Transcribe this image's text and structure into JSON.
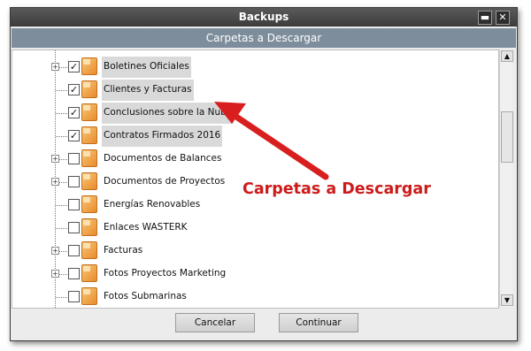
{
  "window": {
    "title": "Backups",
    "minimize_glyph": "▬",
    "close_glyph": "✕"
  },
  "header": {
    "title": "Carpetas a Descargar"
  },
  "tree": {
    "items": [
      {
        "label": "Boletines Oficiales",
        "checked": true,
        "expandable": true,
        "selected": true
      },
      {
        "label": "Clientes y Facturas",
        "checked": true,
        "expandable": false,
        "selected": true
      },
      {
        "label": "Conclusiones sobre la Nube",
        "checked": true,
        "expandable": false,
        "selected": true
      },
      {
        "label": "Contratos Firmados 2016",
        "checked": true,
        "expandable": false,
        "selected": true
      },
      {
        "label": "Documentos de Balances",
        "checked": false,
        "expandable": true,
        "selected": false
      },
      {
        "label": "Documentos de Proyectos",
        "checked": false,
        "expandable": true,
        "selected": false
      },
      {
        "label": "Energías Renovables",
        "checked": false,
        "expandable": false,
        "selected": false
      },
      {
        "label": "Enlaces WASTERK",
        "checked": false,
        "expandable": false,
        "selected": false
      },
      {
        "label": "Facturas",
        "checked": false,
        "expandable": true,
        "selected": false
      },
      {
        "label": "Fotos Proyectos Marketing",
        "checked": false,
        "expandable": true,
        "selected": false
      },
      {
        "label": "Fotos Submarinas",
        "checked": false,
        "expandable": false,
        "selected": false
      }
    ],
    "check_glyph": "✓",
    "expand_glyph": "+"
  },
  "scrollbar": {
    "up_glyph": "▲",
    "down_glyph": "▼"
  },
  "buttons": {
    "cancel": "Cancelar",
    "continue": "Continuar"
  },
  "annotation": {
    "text": "Carpetas a Descargar",
    "color": "#cc1b1b"
  },
  "colors": {
    "header_bg": "#7d8d9c",
    "selection_bg": "#d9d9d9",
    "folder": "#e98a2a"
  }
}
